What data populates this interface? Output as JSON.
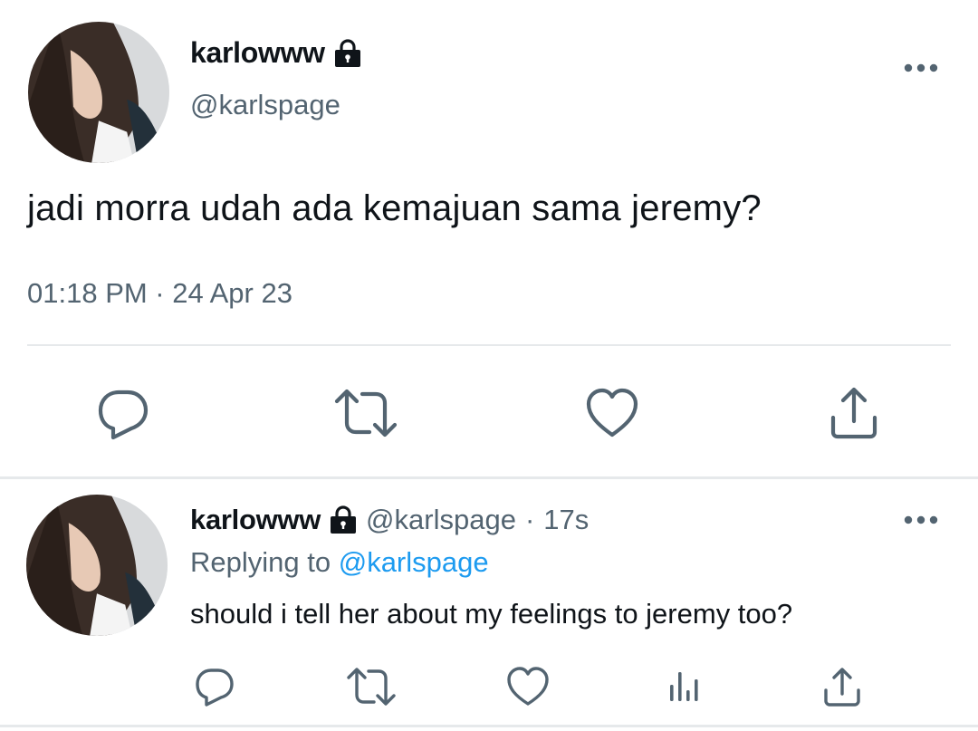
{
  "main_tweet": {
    "author_name": "karlowww",
    "author_handle": "@karlspage",
    "text": "jadi morra udah ada kemajuan sama jeremy?",
    "timestamp": "01:18 PM · 24 Apr 23",
    "protected_icon": "lock-icon",
    "more_icon": "more-horizontal-icon",
    "actions": [
      "reply-icon",
      "retweet-icon",
      "like-icon",
      "share-icon"
    ]
  },
  "reply_tweet": {
    "author_name": "karlowww",
    "author_handle": "@karlspage",
    "separator": "·",
    "time_ago": "17s",
    "replying_label": "Replying to",
    "replying_handle": "@karlspage",
    "text": "should i tell her about my feelings to jeremy too?",
    "protected_icon": "lock-icon",
    "more_icon": "more-horizontal-icon",
    "actions": [
      "reply-icon",
      "retweet-icon",
      "like-icon",
      "views-icon",
      "share-icon"
    ]
  },
  "colors": {
    "text_primary": "#0f1419",
    "text_secondary": "#536471",
    "link": "#1d9bf0",
    "icon": "#536471",
    "divider": "#e6e9eb"
  }
}
